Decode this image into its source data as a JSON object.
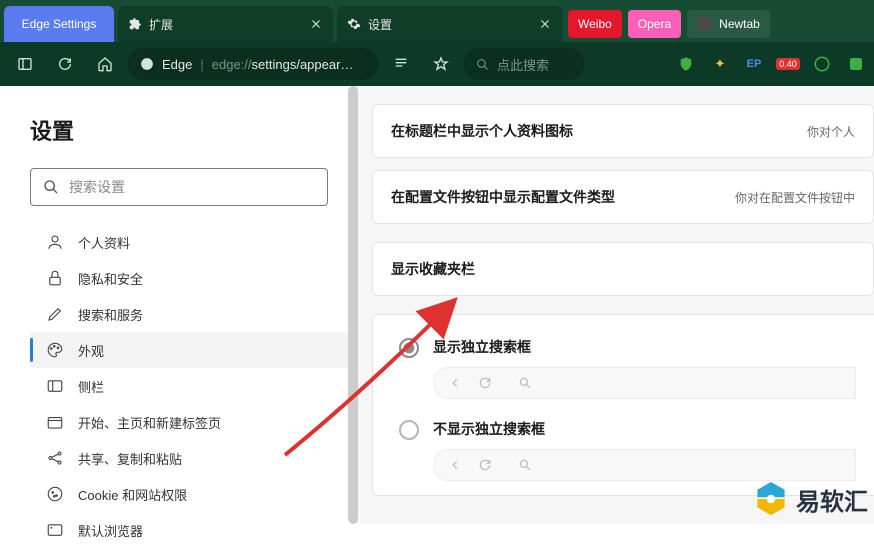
{
  "tabs": [
    {
      "label": "Edge Settings",
      "type": "active"
    },
    {
      "label": "扩展",
      "type": "green"
    },
    {
      "label": "设置",
      "type": "green"
    }
  ],
  "pills": [
    {
      "label": "Weibo",
      "class": "pill-red"
    },
    {
      "label": "Opera",
      "class": "pill-pink"
    },
    {
      "label": "Newtab",
      "class": "pill-dark"
    }
  ],
  "toolbar": {
    "browser_label": "Edge",
    "url_prefix": "edge://",
    "url_rest": "settings/appear…",
    "search_placeholder": "点此搜索",
    "ext_badge": "0.40"
  },
  "sidebar": {
    "title": "设置",
    "search_placeholder": "搜索设置",
    "items": [
      {
        "label": "个人资料"
      },
      {
        "label": "隐私和安全"
      },
      {
        "label": "搜索和服务"
      },
      {
        "label": "外观"
      },
      {
        "label": "侧栏"
      },
      {
        "label": "开始、主页和新建标签页"
      },
      {
        "label": "共享、复制和粘贴"
      },
      {
        "label": "Cookie 和网站权限"
      },
      {
        "label": "默认浏览器"
      }
    ],
    "selected_index": 3
  },
  "main": {
    "row1": {
      "title": "在标题栏中显示个人资料图标",
      "desc": "你对个人"
    },
    "row2": {
      "title": "在配置文件按钮中显示配置文件类型",
      "desc": "你对在配置文件按钮中"
    },
    "fav_section": "显示收藏夹栏",
    "opt1": "显示独立搜索框",
    "opt2": "不显示独立搜索框"
  },
  "watermark": "易软汇"
}
